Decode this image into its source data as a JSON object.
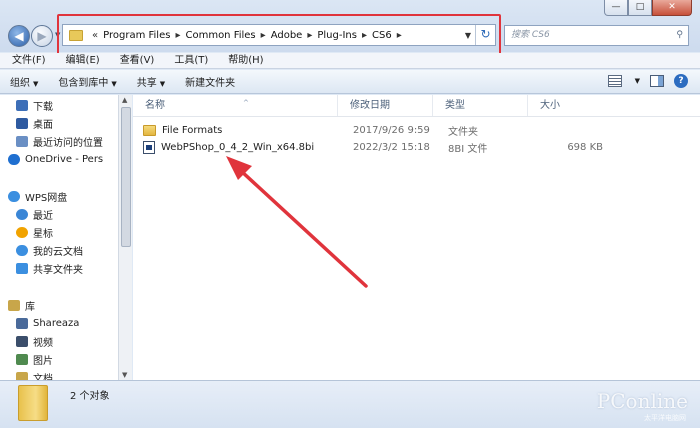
{
  "window": {
    "controls": {
      "minimize": "—",
      "maximize": "□",
      "close": "✕"
    }
  },
  "nav": {
    "back_icon": "◀",
    "forward_icon": "▶",
    "history_icon": "▼"
  },
  "address": {
    "breadcrumbs": [
      "Program Files",
      "Common Files",
      "Adobe",
      "Plug-Ins",
      "CS6"
    ],
    "separator": "▸",
    "overflow": "«",
    "dropdown_icon": "▼",
    "refresh_icon": "↻"
  },
  "search": {
    "placeholder": "搜索 CS6",
    "icon": "⚲"
  },
  "menu": [
    "文件(F)",
    "编辑(E)",
    "查看(V)",
    "工具(T)",
    "帮助(H)"
  ],
  "commands": {
    "organize": "组织",
    "include_library": "包含到库中",
    "share": "共享",
    "new_folder": "新建文件夹",
    "dropdown_icon": "▼",
    "help_icon": "?"
  },
  "sidebar": {
    "items": [
      {
        "label": "下载",
        "icon": "downloads-icon",
        "color": "#3d6fb8"
      },
      {
        "label": "桌面",
        "icon": "desktop-icon",
        "color": "#2e5aa0"
      },
      {
        "label": "最近访问的位置",
        "icon": "recent-places-icon",
        "color": "#6a8fc4"
      },
      {
        "label": "OneDrive - Pers",
        "icon": "onedrive-icon",
        "color": "#1f6fd0"
      },
      {
        "label": "WPS网盘",
        "icon": "wps-cloud-icon",
        "color": "#3b8fe0"
      },
      {
        "label": "最近",
        "icon": "clock-icon",
        "color": "#3a86d6"
      },
      {
        "label": "星标",
        "icon": "star-icon",
        "color": "#f1a300"
      },
      {
        "label": "我的云文档",
        "icon": "cloud-doc-icon",
        "color": "#3b8fe0"
      },
      {
        "label": "共享文件夹",
        "icon": "shared-folder-icon",
        "color": "#3b8fe0"
      },
      {
        "label": "库",
        "icon": "library-icon",
        "color": "#c8a64a"
      },
      {
        "label": "Shareaza",
        "icon": "shareaza-icon",
        "color": "#4a6a9a"
      },
      {
        "label": "视频",
        "icon": "videos-icon",
        "color": "#3b4e6b"
      },
      {
        "label": "图片",
        "icon": "pictures-icon",
        "color": "#4f8a4f"
      },
      {
        "label": "文档",
        "icon": "documents-icon",
        "color": "#c8a64a"
      }
    ]
  },
  "columns": {
    "name": "名称",
    "modified": "修改日期",
    "type": "类型",
    "size": "大小",
    "sort_icon": "^"
  },
  "files": [
    {
      "name": "File Formats",
      "modified": "2017/9/26 9:59",
      "type": "文件夹",
      "size": "",
      "icon": "folder-icon"
    },
    {
      "name": "WebPShop_0_4_2_Win_x64.8bi",
      "modified": "2022/3/2 15:18",
      "type": "8BI 文件",
      "size": "698 KB",
      "icon": "plugin-file-icon"
    }
  ],
  "status": {
    "count": "2 个对象"
  },
  "watermark": {
    "text": "PConline",
    "sub": "太平洋电脑网"
  },
  "colors": {
    "annotation_red": "#e0343c"
  }
}
